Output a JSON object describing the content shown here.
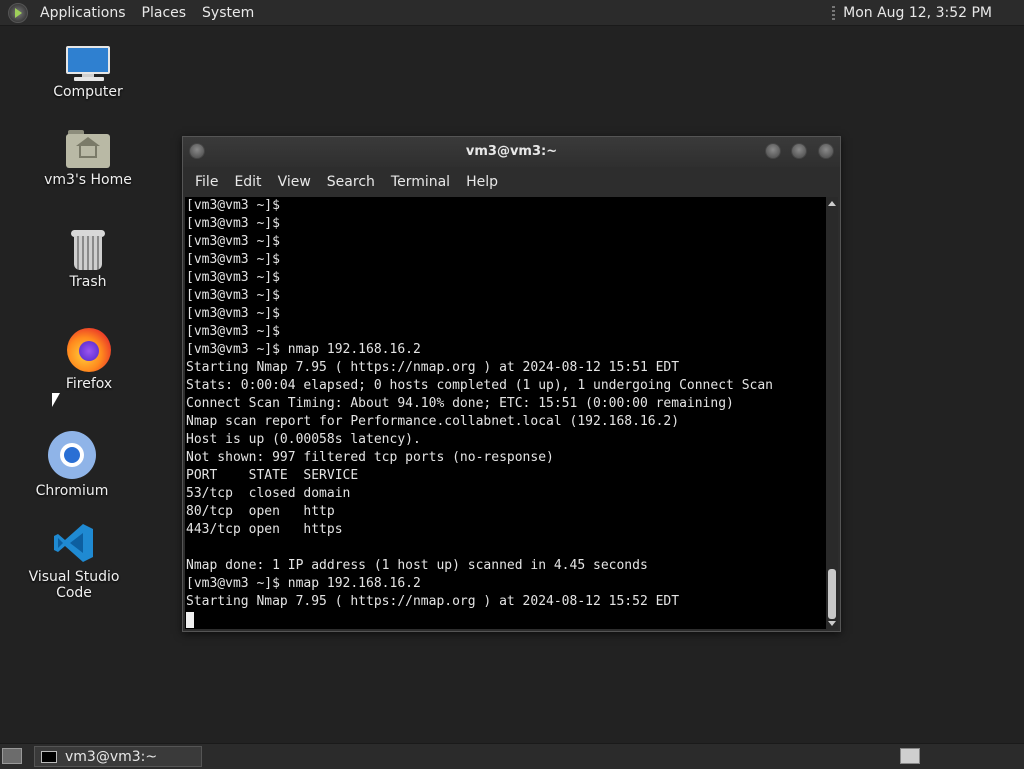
{
  "top_panel": {
    "menus": [
      "Applications",
      "Places",
      "System"
    ],
    "clock": "Mon Aug 12,  3:52 PM"
  },
  "desktop_icons": {
    "computer": "Computer",
    "home": "vm3's Home",
    "trash": "Trash",
    "firefox": "Firefox",
    "chromium": "Chromium",
    "vscode": "Visual Studio Code"
  },
  "terminal": {
    "title": "vm3@vm3:~",
    "menus": [
      "File",
      "Edit",
      "View",
      "Search",
      "Terminal",
      "Help"
    ],
    "lines": [
      "[vm3@vm3 ~]$",
      "[vm3@vm3 ~]$",
      "[vm3@vm3 ~]$",
      "[vm3@vm3 ~]$",
      "[vm3@vm3 ~]$",
      "[vm3@vm3 ~]$",
      "[vm3@vm3 ~]$",
      "[vm3@vm3 ~]$",
      "[vm3@vm3 ~]$ nmap 192.168.16.2",
      "Starting Nmap 7.95 ( https://nmap.org ) at 2024-08-12 15:51 EDT",
      "Stats: 0:00:04 elapsed; 0 hosts completed (1 up), 1 undergoing Connect Scan",
      "Connect Scan Timing: About 94.10% done; ETC: 15:51 (0:00:00 remaining)",
      "Nmap scan report for Performance.collabnet.local (192.168.16.2)",
      "Host is up (0.00058s latency).",
      "Not shown: 997 filtered tcp ports (no-response)",
      "PORT    STATE  SERVICE",
      "53/tcp  closed domain",
      "80/tcp  open   http",
      "443/tcp open   https",
      "",
      "Nmap done: 1 IP address (1 host up) scanned in 4.45 seconds",
      "[vm3@vm3 ~]$ nmap 192.168.16.2",
      "Starting Nmap 7.95 ( https://nmap.org ) at 2024-08-12 15:52 EDT"
    ]
  },
  "taskbar": {
    "window_label": "vm3@vm3:~"
  },
  "colors": {
    "desktop_bg": "#222222",
    "terminal_bg": "#000000",
    "terminal_fg": "#e4e4e4"
  }
}
